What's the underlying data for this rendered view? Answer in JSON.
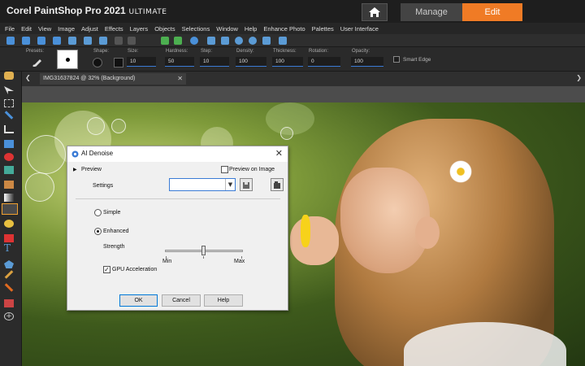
{
  "app": {
    "brand_main": "Corel PaintShop Pro 2021",
    "brand_edition": "ULTIMATE",
    "tabs": {
      "manage": "Manage",
      "edit": "Edit"
    },
    "colors": {
      "accent": "#f07b25",
      "titlebar": "#1e1e1e"
    }
  },
  "menu": [
    "File",
    "Edit",
    "View",
    "Image",
    "Adjust",
    "Effects",
    "Layers",
    "Objects",
    "Selections",
    "Window",
    "Help",
    "Enhance Photo",
    "Palettes",
    "User Interface"
  ],
  "options": {
    "presets": "Presets:",
    "shape": "Shape:",
    "size": {
      "label": "Size:",
      "value": "10"
    },
    "hardness": {
      "label": "Hardness:",
      "value": "50"
    },
    "step": {
      "label": "Step:",
      "value": "10"
    },
    "density": {
      "label": "Density:",
      "value": "100"
    },
    "thickness": {
      "label": "Thickness:",
      "value": "100"
    },
    "rotation": {
      "label": "Rotation:",
      "value": "0"
    },
    "opacity": {
      "label": "Opacity:",
      "value": "100"
    },
    "smart_edge": "Smart Edge"
  },
  "document": {
    "tab_title": "IMG31637824 @  32% (Background)"
  },
  "dialog": {
    "title": "AI Denoise",
    "preview_section": "Preview",
    "preview_on_image": "Preview on Image",
    "settings_label": "Settings",
    "settings_value": "",
    "simple": "Simple",
    "enhanced": "Enhanced",
    "strength": "Strength",
    "strength_value": 0.5,
    "min": "Min",
    "max": "Max",
    "gpu": "GPU Acceleration",
    "ok": "OK",
    "cancel": "Cancel",
    "help": "Help"
  }
}
